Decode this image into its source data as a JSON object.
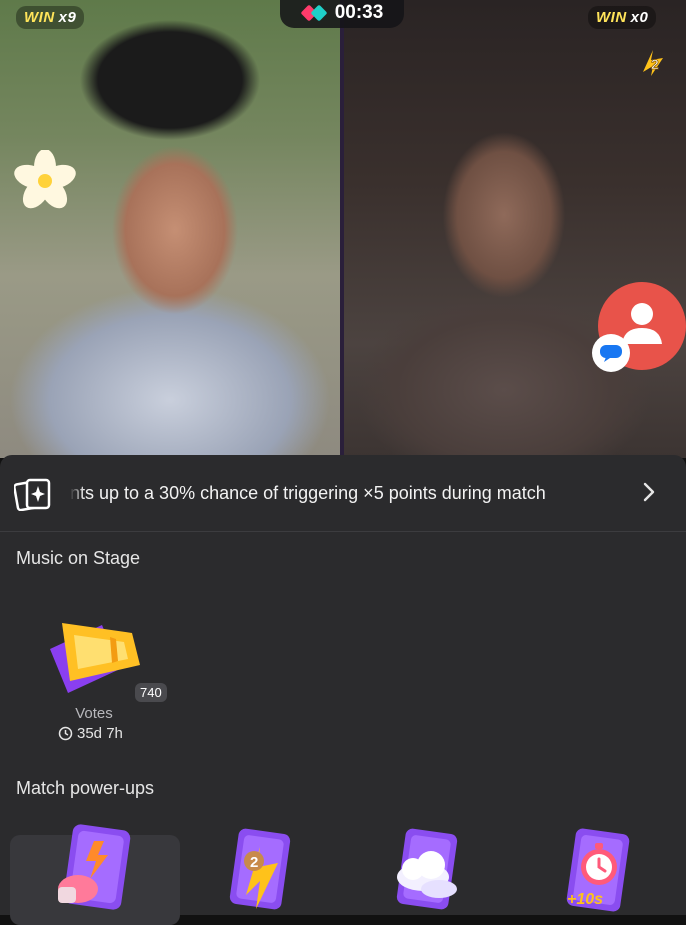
{
  "battle": {
    "timer": "00:33",
    "left_player": {
      "win_label": "WIN",
      "win_count": "x9"
    },
    "right_player": {
      "win_label": "WIN",
      "win_count": "x0"
    }
  },
  "icons": {
    "timer": "battle-logo-icon",
    "flower_effect": "plumeria-flower-icon",
    "rank_badge": "rank-2-lightning-icon",
    "profile_button": "person-icon",
    "chat": "chat-bubble-icon",
    "banner": "sparkle-cards-icon",
    "banner_arrow": "chevron-right-icon"
  },
  "banner": {
    "text": "nts up to a 30% chance of triggering ×5 points during match"
  },
  "music_on_stage": {
    "title": "Music on Stage",
    "ticket_count": "740",
    "votes_label": "Votes",
    "time_left": "35d 7h"
  },
  "match_powerups": {
    "title": "Match power-ups",
    "items": [
      {
        "icon": "boxing-glove-card-icon",
        "selected": true
      },
      {
        "icon": "rank-2-lightning-card-icon",
        "selected": false
      },
      {
        "icon": "cloud-card-icon",
        "selected": false
      },
      {
        "icon": "stopwatch-plus10-card-icon",
        "selected": false,
        "caption": "+10s"
      }
    ]
  },
  "colors": {
    "win_label": "#ffe45a",
    "sheet_bg": "#2b2b2d",
    "profile_button": "#e8534a",
    "powerup_card": "#8a4df0"
  }
}
